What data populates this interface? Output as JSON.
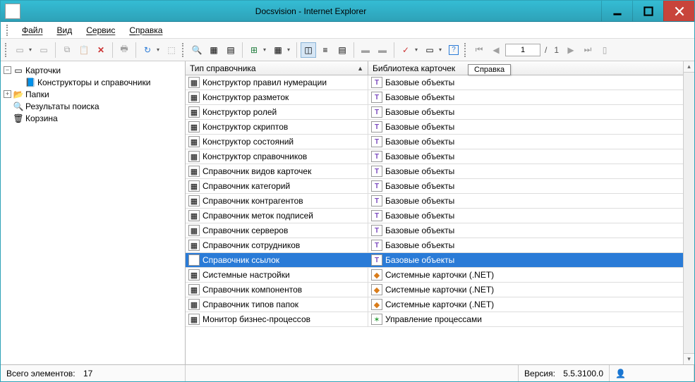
{
  "window": {
    "title": "Docsvision - Internet Explorer"
  },
  "menu": {
    "file": "Файл",
    "view": "Вид",
    "service": "Сервис",
    "help": "Справка"
  },
  "toolbar": {
    "page_current": "1",
    "page_sep": "/",
    "page_total": "1"
  },
  "tooltip": "Справка",
  "tree": {
    "cards": "Карточки",
    "constructors": "Конструкторы и справочники",
    "folders": "Папки",
    "results": "Результаты поиска",
    "trash": "Корзина"
  },
  "grid": {
    "col1": "Тип справочника",
    "col2": "Библиотека карточек",
    "rows": [
      {
        "t": "Конструктор правил нумерации",
        "l": "Базовые объекты",
        "li": "lib"
      },
      {
        "t": "Конструктор разметок",
        "l": "Базовые объекты",
        "li": "lib"
      },
      {
        "t": "Конструктор ролей",
        "l": "Базовые объекты",
        "li": "lib"
      },
      {
        "t": "Конструктор скриптов",
        "l": "Базовые объекты",
        "li": "lib"
      },
      {
        "t": "Конструктор состояний",
        "l": "Базовые объекты",
        "li": "lib"
      },
      {
        "t": "Конструктор справочников",
        "l": "Базовые объекты",
        "li": "lib"
      },
      {
        "t": "Справочник видов карточек",
        "l": "Базовые объекты",
        "li": "lib"
      },
      {
        "t": "Справочник категорий",
        "l": "Базовые объекты",
        "li": "lib"
      },
      {
        "t": "Справочник контрагентов",
        "l": "Базовые объекты",
        "li": "lib"
      },
      {
        "t": "Справочник меток подписей",
        "l": "Базовые объекты",
        "li": "lib"
      },
      {
        "t": "Справочник серверов",
        "l": "Базовые объекты",
        "li": "lib"
      },
      {
        "t": "Справочник сотрудников",
        "l": "Базовые объекты",
        "li": "lib"
      },
      {
        "t": "Справочник ссылок",
        "l": "Базовые объекты",
        "li": "lib",
        "sel": true
      },
      {
        "t": "Системные настройки",
        "l": "Системные карточки (.NET)",
        "li": "sys"
      },
      {
        "t": "Справочник компонентов",
        "l": "Системные карточки (.NET)",
        "li": "sys"
      },
      {
        "t": "Справочник типов папок",
        "l": "Системные карточки (.NET)",
        "li": "sys"
      },
      {
        "t": "Монитор бизнес-процессов",
        "l": "Управление процессами",
        "li": "proc"
      }
    ]
  },
  "status": {
    "total_label": "Всего элементов:",
    "total_value": "17",
    "version_label": "Версия:",
    "version_value": "5.5.3100.0"
  }
}
